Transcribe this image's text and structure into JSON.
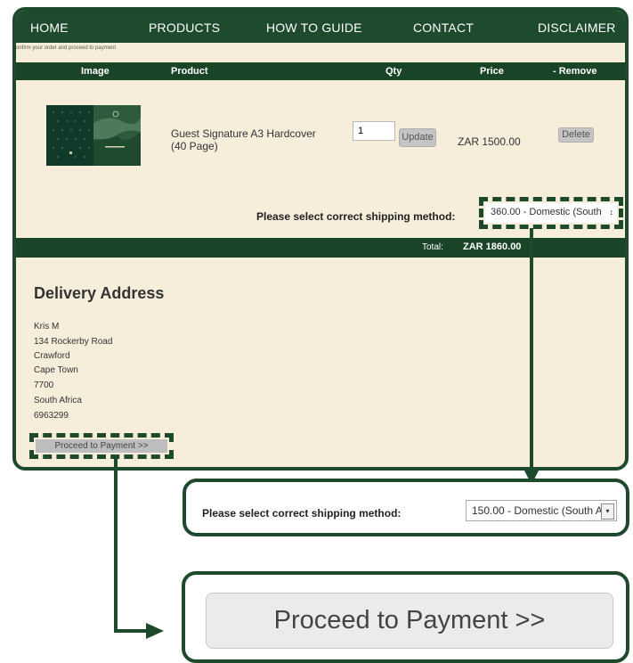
{
  "nav": {
    "items": [
      "HOME",
      "PRODUCTS",
      "HOW TO GUIDE",
      "CONTACT",
      "DISCLAIMER"
    ],
    "subtext": "onfirm your order and proceed to payment"
  },
  "table": {
    "headers": {
      "image": "Image",
      "product": "Product",
      "qty": "Qty",
      "price": "Price",
      "remove": "- Remove"
    },
    "row": {
      "product": "Guest Signature A3 Hardcover (40 Page)",
      "qty": "1",
      "update_label": "Update",
      "price": "ZAR 1500.00",
      "delete_label": "Delete"
    }
  },
  "shipping": {
    "label": "Please select correct shipping method:",
    "selected": "360.00 - Domestic (South",
    "arrows": "↕"
  },
  "total": {
    "label": "Total:",
    "value": "ZAR 1860.00"
  },
  "delivery": {
    "title": "Delivery Address",
    "lines": [
      "Kris M",
      "134 Rockerby Road",
      "Crawford",
      "Cape Town",
      "7700",
      "South Africa",
      "6963299"
    ]
  },
  "proceed_label": "Proceed to Payment >>",
  "zoom_shipping": {
    "label": "Please select correct shipping method:",
    "selected": "150.00 - Domestic (South A",
    "arrow": "▾"
  },
  "zoom_payment": {
    "label": "Proceed to Payment >>"
  },
  "colors": {
    "brand_green": "#1e4a2e",
    "page_cream": "#f6eddb",
    "callout_border": "#1d4a2c"
  }
}
